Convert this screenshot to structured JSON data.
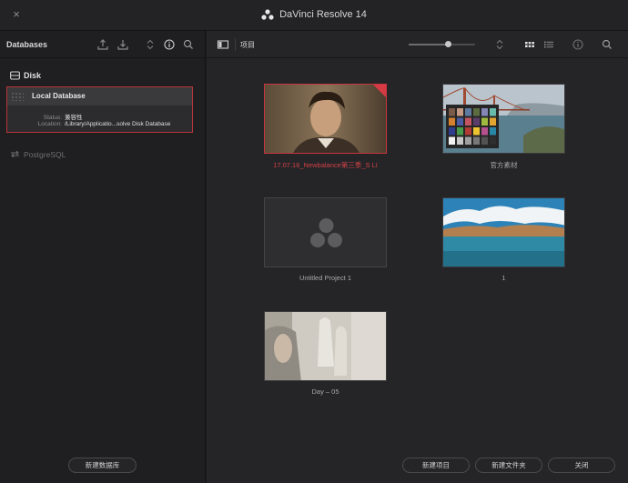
{
  "window": {
    "title": "DaVinci Resolve 14",
    "close_glyph": "×"
  },
  "sidebar": {
    "title": "Databases",
    "icons": [
      "upload-icon",
      "download-icon",
      "sort-icon",
      "info-icon",
      "search-icon"
    ],
    "disk_group": {
      "label": "Disk",
      "icon": "disk-icon"
    },
    "local_db": {
      "name": "Local Database",
      "status_key": "Status:",
      "status_value": "兼容性",
      "location_key": "Location:",
      "location_value": "/Library/Applicatio...solve Disk Database"
    },
    "postgres": {
      "label": "PostgreSQL",
      "icon": "connect-icon"
    },
    "new_db_button": "新建数据库"
  },
  "main": {
    "toolbar": {
      "panel_label": "项目",
      "zoom_percent": 60,
      "icons": [
        "sidebar-toggle-icon",
        "sort-icon",
        "grid-view-icon",
        "list-view-icon",
        "info-icon",
        "search-icon"
      ]
    },
    "projects": [
      {
        "name": "17.07.16_Newbalance第三季_S LI",
        "selected": true,
        "thumb": "portrait"
      },
      {
        "name": "官方素材",
        "selected": false,
        "thumb": "bridge"
      },
      {
        "name": "Untitled Project 1",
        "selected": false,
        "thumb": "empty"
      },
      {
        "name": "1",
        "selected": false,
        "thumb": "lake"
      },
      {
        "name": "Day – 05",
        "selected": false,
        "thumb": "hands"
      }
    ],
    "buttons": {
      "new_project": "新建项目",
      "new_folder": "新建文件夹",
      "close": "关闭"
    }
  },
  "colors": {
    "accent_red": "#c7353e",
    "panel_bg": "#252528",
    "sidebar_bg": "#1f1f21"
  }
}
